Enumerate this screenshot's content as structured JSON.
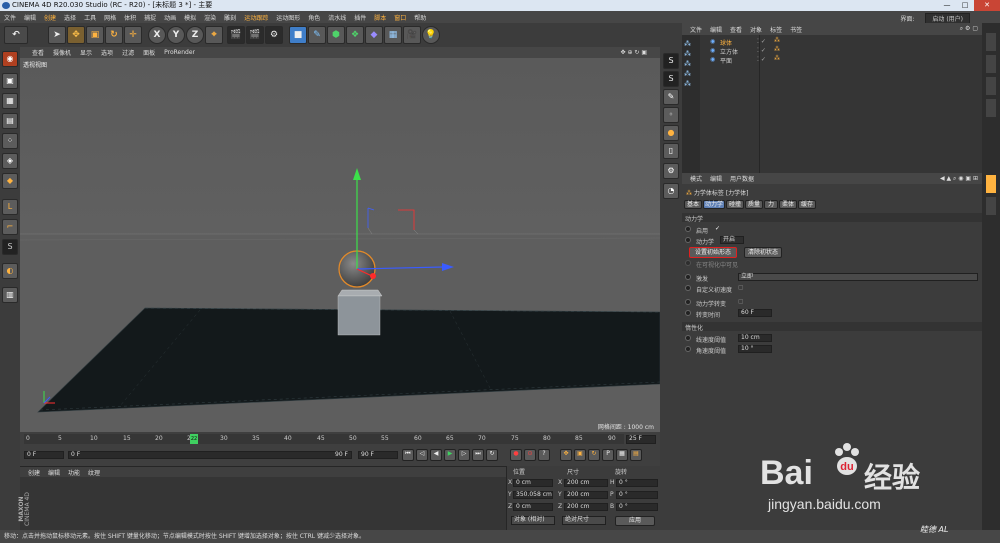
{
  "window": {
    "title": "CINEMA 4D R20.030 Studio (RC - R20) - [未标题 3 *] - 主要",
    "minimize": "—",
    "maximize": "□",
    "close": "✕"
  },
  "menu": {
    "items": [
      "文件",
      "编辑",
      "创建",
      "选择",
      "工具",
      "网格",
      "体积",
      "捕捉",
      "动画",
      "模拟",
      "渲染",
      "雕刻",
      "运动跟踪",
      "运动图形",
      "角色",
      "流水线",
      "插件",
      "脚本",
      "窗口",
      "帮助"
    ],
    "layout_label": "界面:",
    "layout_value": "启动 (用户)"
  },
  "toolbar": {
    "axis_x": "X",
    "axis_y": "Y",
    "axis_z": "Z"
  },
  "viewport": {
    "menu": [
      "查看",
      "摄像机",
      "显示",
      "选项",
      "过滤",
      "面板",
      "ProRender"
    ],
    "label": "透视视图",
    "grid_spacing": "网格间距 : 1000 cm"
  },
  "timeline": {
    "ticks": [
      "0",
      "5",
      "10",
      "15",
      "20",
      "25",
      "30",
      "35",
      "40",
      "45",
      "50",
      "55",
      "60",
      "65",
      "70",
      "75",
      "80",
      "85",
      "90"
    ],
    "current_frame_marker": "22",
    "frame_display": "25 F",
    "start_frame": "0 F",
    "min_frame": "0 F",
    "max_frame": "90 F",
    "end_frame": "90 F"
  },
  "material_manager": {
    "menu": [
      "创建",
      "编辑",
      "功能",
      "纹理"
    ],
    "brand_line1": "MAXON",
    "brand_line2": "CINEMA 4D"
  },
  "coordinates": {
    "headers": [
      "位置",
      "尺寸",
      "旋转"
    ],
    "rows": [
      {
        "pos_axis": "X",
        "pos": "0 cm",
        "size_axis": "X",
        "size": "200 cm",
        "rot_axis": "H",
        "rot": "0 °"
      },
      {
        "pos_axis": "Y",
        "pos": "350.058 cm",
        "size_axis": "Y",
        "size": "200 cm",
        "rot_axis": "P",
        "rot": "0 °"
      },
      {
        "pos_axis": "Z",
        "pos": "0 cm",
        "size_axis": "Z",
        "size": "200 cm",
        "rot_axis": "B",
        "rot": "0 °"
      }
    ],
    "mode": "对象 (相对)",
    "size_mode": "绝对尺寸",
    "apply": "应用"
  },
  "object_manager": {
    "menu": [
      "文件",
      "编辑",
      "查看",
      "对象",
      "标签",
      "书签"
    ],
    "objects": [
      {
        "name": "球体"
      },
      {
        "name": "立方体"
      },
      {
        "name": "平面"
      }
    ]
  },
  "attribute_manager": {
    "menu": [
      "模式",
      "编辑",
      "用户数据"
    ],
    "tag_title": "力学体标签 [力学体]",
    "tabs": [
      "基本",
      "动力学",
      "碰撞",
      "质量",
      "力",
      "柔体",
      "缓存"
    ],
    "active_tab": "动力学",
    "section_dynamics": "动力学",
    "enabled_label": "启用",
    "enabled_value": "✓",
    "dynamic_label": "动力学",
    "dynamic_value": "开启",
    "set_initial_btn": "设置初始形态",
    "clear_initial_btn": "清除初状态",
    "viewport_visible_label": "在可视化中可见",
    "trigger_label": "激发",
    "trigger_value": "立即",
    "custom_init_vel_label": "自定义初速度",
    "dyn_transition_label": "动力学转变",
    "transition_time_label": "转变时间",
    "transition_time_value": "60 F",
    "section_sleep": "惰性化",
    "linear_threshold_label": "线速度阈值",
    "linear_threshold_value": "10 cm",
    "angular_threshold_label": "角速度阈值",
    "angular_threshold_value": "10 °"
  },
  "status": {
    "text": "移动：点击并拖动鼠标移动元素。按住 SHIFT 键量化移动；节点编辑模式时按住 SHIFT 键增加选择对象；按住 CTRL 键减少选择对象。"
  },
  "watermark": {
    "brand": "Bai",
    "brand2": "经验",
    "url": "jingyan.baidu.com",
    "sign": "睦德 AL"
  },
  "colors": {
    "highlight": "#ffb340",
    "active_tab": "#5d7fb5",
    "set_initial_border": "#e02020"
  }
}
